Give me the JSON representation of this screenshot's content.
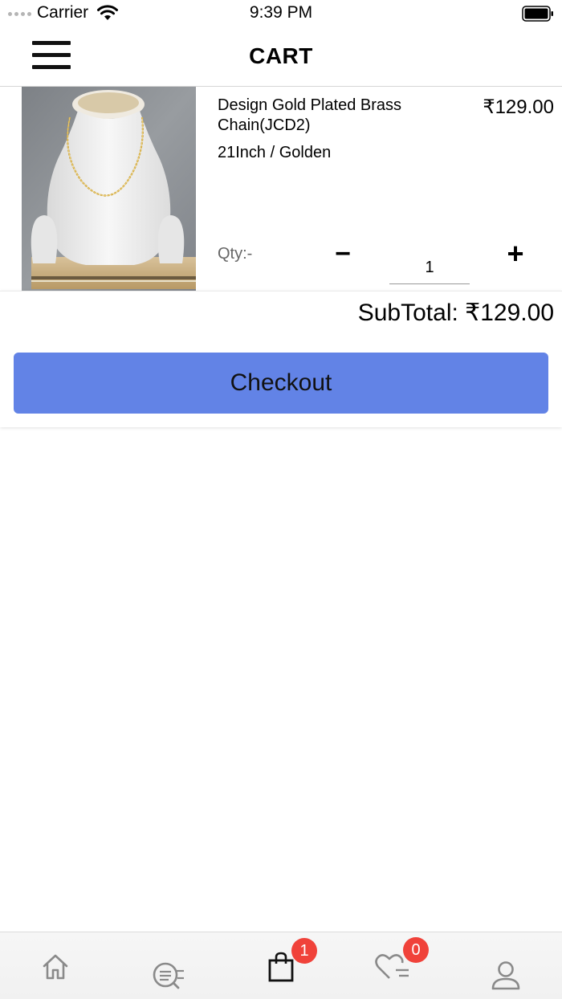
{
  "status_bar": {
    "carrier": "Carrier",
    "time": "9:39 PM"
  },
  "header": {
    "title": "CART"
  },
  "cart": {
    "items": [
      {
        "name": "Design Gold Plated Brass Chain(JCD2)",
        "price": "₹129.00",
        "variant": "21Inch / Golden",
        "qty_label": "Qty:-",
        "quantity": "1",
        "minus_label": "−",
        "plus_label": "+"
      }
    ],
    "subtotal": "SubTotal: ₹129.00",
    "checkout_label": "Checkout"
  },
  "tab_bar": {
    "tabs": [
      {
        "icon": "home-icon"
      },
      {
        "icon": "search-list-icon"
      },
      {
        "icon": "shopping-bag-icon",
        "badge": "1"
      },
      {
        "icon": "wishlist-heart-icon",
        "badge": "0"
      },
      {
        "icon": "user-icon"
      }
    ]
  },
  "colors": {
    "checkout_button": "#6283e6",
    "badge": "#f0423a"
  }
}
